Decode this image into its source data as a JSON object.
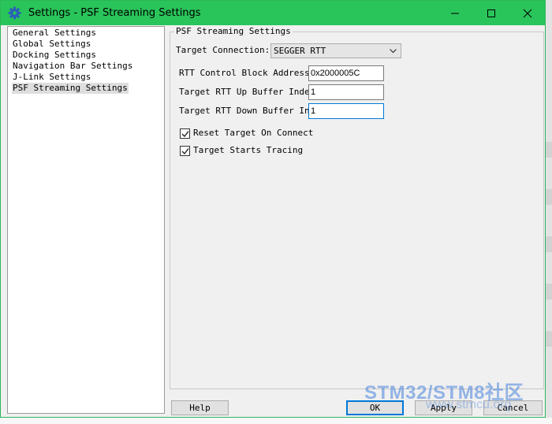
{
  "window": {
    "title": "Settings - PSF Streaming Settings",
    "accent_color": "#29c45a"
  },
  "sidebar": {
    "items": [
      {
        "label": "General Settings"
      },
      {
        "label": "Global Settings"
      },
      {
        "label": "Docking Settings"
      },
      {
        "label": "Navigation Bar Settings"
      },
      {
        "label": "J-Link Settings"
      },
      {
        "label": "PSF Streaming Settings",
        "selected": true
      }
    ]
  },
  "psf": {
    "group_title": "PSF Streaming Settings",
    "target_connection_label": "Target Connection:",
    "target_connection_value": "SEGGER RTT",
    "rtt_address_label": "RTT Control Block Address:",
    "rtt_address_value": "0x2000005C",
    "up_buffer_label": "Target RTT Up Buffer Index:",
    "up_buffer_value": "1",
    "down_buffer_label": "Target RTT Down Buffer Index:",
    "down_buffer_value": "1",
    "reset_target_label": "Reset Target On Connect",
    "reset_target_checked": true,
    "starts_tracing_label": "Target Starts Tracing",
    "starts_tracing_checked": true
  },
  "buttons": {
    "help": "Help",
    "ok": "OK",
    "apply": "Apply",
    "cancel": "Cancel"
  },
  "watermark": {
    "text": "STM32/STM8社区",
    "sub": "www.stmcu.org"
  }
}
